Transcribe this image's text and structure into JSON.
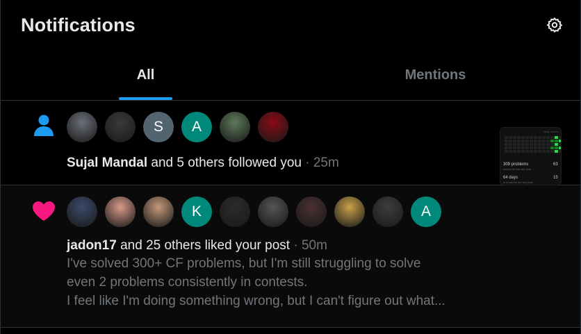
{
  "header": {
    "title": "Notifications",
    "settings_icon": "gear-icon"
  },
  "tabs": [
    {
      "label": "All",
      "active": true
    },
    {
      "label": "Mentions",
      "active": false
    }
  ],
  "notifications": [
    {
      "type": "follow",
      "icon": "person-icon",
      "icon_color": "#1d9bf0",
      "actor": "Sujal Mandal",
      "action": " and 5 others followed you",
      "separator": " · ",
      "time": "25m",
      "avatars": [
        {
          "letter": "",
          "color": "#6b6f78"
        },
        {
          "letter": "",
          "color": "#3a3a3a"
        },
        {
          "letter": "S",
          "color": "#536471"
        },
        {
          "letter": "A",
          "color": "#00897b"
        },
        {
          "letter": "",
          "color": "#5d7a5a"
        },
        {
          "letter": "",
          "color": "#8b0a14"
        }
      ]
    },
    {
      "type": "like",
      "icon": "heart-icon",
      "icon_color": "#f91880",
      "actor": "jadon17",
      "action": " and 25 others liked your post",
      "separator": " · ",
      "time": "50m",
      "preview_lines": [
        "I've solved 300+ CF problems, but I'm still struggling to solve",
        "even 2 problems consistently in contests.",
        "I feel like I'm doing something wrong, but I can't figure out what..."
      ],
      "avatars": [
        {
          "letter": "",
          "color": "#3b4a6b"
        },
        {
          "letter": "",
          "color": "#d99a8a"
        },
        {
          "letter": "",
          "color": "#c49a7a"
        },
        {
          "letter": "K",
          "color": "#00897b"
        },
        {
          "letter": "",
          "color": "#2b2b2b"
        },
        {
          "letter": "",
          "color": "#555555"
        },
        {
          "letter": "",
          "color": "#4a3030"
        },
        {
          "letter": "",
          "color": "#c9a24a"
        },
        {
          "letter": "",
          "color": "#3d3d3d"
        },
        {
          "letter": "A",
          "color": "#00897b"
        }
      ],
      "thumbnail": {
        "stat1": "309 problems",
        "stat1_sub": "solved for the last year",
        "stat2": "64 days",
        "stat2_sub": "in a row for the last year",
        "right1": "63",
        "right2": "15",
        "corner": "Most recent"
      }
    }
  ]
}
